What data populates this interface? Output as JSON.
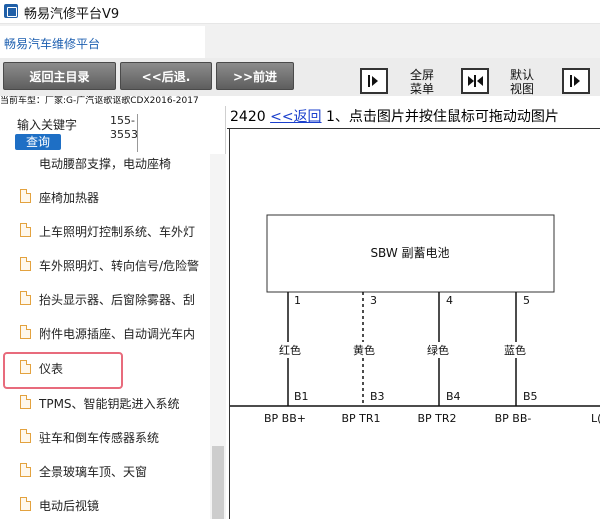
{
  "window": {
    "title": "畅易汽修平台V9"
  },
  "tab": {
    "label": "畅易汽车维修平台"
  },
  "toolbar": {
    "home_label": "返回主目录",
    "back_label": "<<后退.",
    "forward_label": ">>前进",
    "fullscreen_label": "全屏菜单",
    "default_view_label": "默认视图"
  },
  "vehicle": {
    "text": "当前车型：厂家:G-广汽讴歌讴歌CDX2016-2017"
  },
  "search": {
    "hint": "输入关键字",
    "phone": "155-3553",
    "button": "查询"
  },
  "tree": {
    "items": [
      {
        "label": "电动腰部支撑，电动座椅"
      },
      {
        "label": "座椅加热器"
      },
      {
        "label": "上车照明灯控制系统、车外灯"
      },
      {
        "label": "车外照明灯、转向信号/危险警"
      },
      {
        "label": "抬头显示器、后窗除雾器、刮"
      },
      {
        "label": "附件电源插座、自动调光车内"
      },
      {
        "label": "仪表"
      },
      {
        "label": "TPMS、智能钥匙进入系统"
      },
      {
        "label": "驻车和倒车传感器系统"
      },
      {
        "label": "全景玻璃车顶、天窗"
      },
      {
        "label": "电动后视镜"
      }
    ]
  },
  "content": {
    "page_number": "2420",
    "return_link": "<<返回",
    "instruction": "1、点击图片并按住鼠标可拖动动图片"
  },
  "diagram": {
    "component": "SBW 副蓄电池",
    "pins": [
      {
        "number": "1",
        "color": "红色",
        "connector": "B1",
        "signal": "BP BB+",
        "dashed": false
      },
      {
        "number": "3",
        "color": "黄色",
        "connector": "B3",
        "signal": "BP TR1",
        "dashed": true
      },
      {
        "number": "4",
        "color": "绿色",
        "connector": "B4",
        "signal": "BP TR2",
        "dashed": false
      },
      {
        "number": "5",
        "color": "蓝色",
        "connector": "B5",
        "signal": "BP BB-",
        "dashed": false
      }
    ],
    "edge_label": "L("
  }
}
